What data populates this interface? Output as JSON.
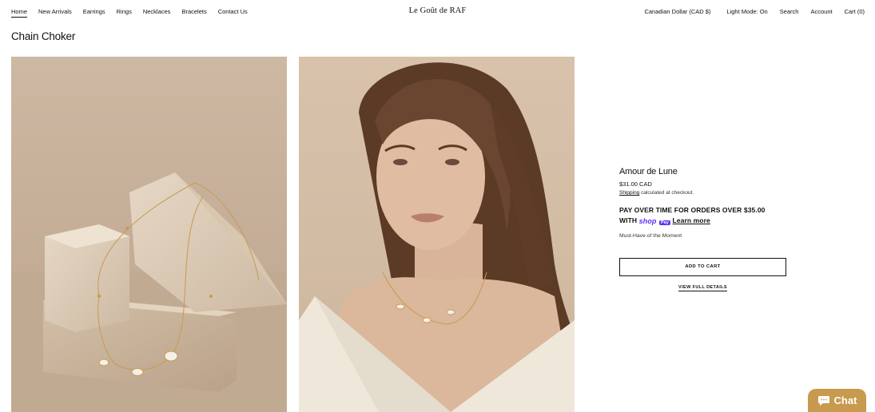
{
  "nav": {
    "left": [
      "Home",
      "New Arrivals",
      "Earrings",
      "Rings",
      "Necklaces",
      "Bracelets",
      "Contact Us"
    ],
    "brand": "Le Goût de RAF",
    "right": {
      "currency": "Canadian Dollar (CAD $)",
      "light_mode": "Light Mode: On",
      "search": "Search",
      "account": "Account",
      "cart": "Cart (0)"
    }
  },
  "page": {
    "title": "Chain Choker"
  },
  "product": {
    "name": "Amour de Lune",
    "price": "$31.00 CAD",
    "shipping_link": "Shipping",
    "shipping_text": " calculated at checkout.",
    "pay_line1": "PAY OVER TIME FOR ORDERS OVER $35.00",
    "pay_with": "WITH ",
    "shop_word": "shop",
    "pay_badge": "Pay",
    "learn_more": "Learn more",
    "tagline": "Must-Have of the Moment",
    "add_to_cart": "ADD TO CART",
    "view_details": "VIEW FULL DETAILS"
  },
  "chat": {
    "label": "Chat"
  },
  "colors": {
    "shop_purple": "#5a31f4",
    "chat_gold": "#c89a4e"
  },
  "icons": {
    "chat": "chat-bubble-icon"
  }
}
